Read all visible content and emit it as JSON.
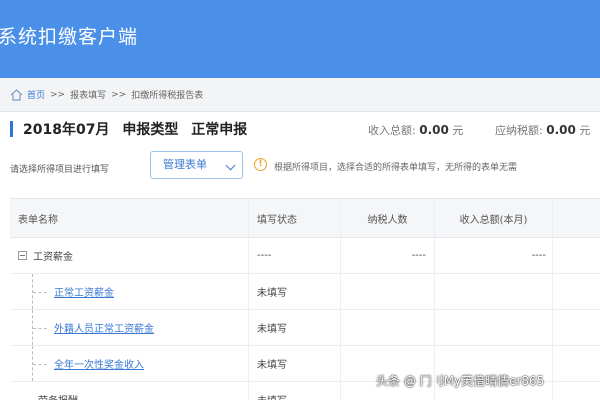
{
  "header": {
    "app_title": "系统扣缴客户端"
  },
  "breadcrumb": {
    "items": [
      "首页",
      "报表填写",
      "扣缴所得税报告表"
    ],
    "separator": ">>"
  },
  "period": {
    "title": "2018年07月",
    "type_label": "申报类型",
    "type_value": "正常申报",
    "income_total_label": "收入总额:",
    "income_total_value": "0.00",
    "income_total_unit": "元",
    "tax_due_label": "应纳税额:",
    "tax_due_value": "0.00",
    "tax_due_unit": "元"
  },
  "toolbar": {
    "hint": "请选择所得项目进行填写",
    "manage_button": "管理表单",
    "warning": "根据所得项目，选择合适的所得表单填写，无所得的表单无需"
  },
  "table": {
    "headers": [
      "表单名称",
      "填写状态",
      "纳税人数",
      "收入总额(本月)"
    ],
    "group": {
      "name": "工资薪金",
      "status": "----",
      "count": "----",
      "income": "----"
    },
    "children": [
      {
        "name": "正常工资薪金",
        "status": "未填写"
      },
      {
        "name": "外籍人员正常工资薪金",
        "status": "未填写"
      },
      {
        "name": "全年一次性奖金收入",
        "status": "未填写"
      }
    ],
    "last_row": {
      "name": "劳务报酬",
      "status": "未填写"
    }
  },
  "watermark": "头条 @ 冂刂My芙偣晴倩er865",
  "colors": {
    "header_bg": "#4a90e8",
    "link": "#3a7ad5",
    "warning": "#f0a020"
  }
}
